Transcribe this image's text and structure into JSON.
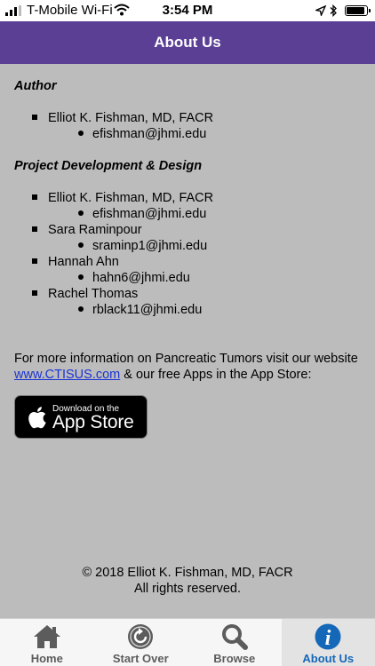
{
  "status_bar": {
    "carrier": "T-Mobile Wi-Fi",
    "time": "3:54 PM",
    "icons": [
      "signal-bars-icon",
      "wifi-icon",
      "location-arrow-icon",
      "bluetooth-icon",
      "battery-icon"
    ]
  },
  "header": {
    "title": "About Us"
  },
  "author_section": {
    "title": "Author",
    "people": [
      {
        "name": "Elliot K. Fishman, MD, FACR",
        "email": "efishman@jhmi.edu"
      }
    ]
  },
  "project_section": {
    "title": "Project Development & Design",
    "people": [
      {
        "name": "Elliot K. Fishman, MD, FACR",
        "email": "efishman@jhmi.edu"
      },
      {
        "name": "Sara Raminpour",
        "email": "sraminp1@jhmi.edu"
      },
      {
        "name": "Hannah Ahn",
        "email": "hahn6@jhmi.edu"
      },
      {
        "name": "Rachel Thomas",
        "email": "rblack11@jhmi.edu"
      }
    ]
  },
  "info": {
    "text_before": "For more information on Pancreatic Tumors visit our website",
    "link": "www.CTISUS.com",
    "text_after": " & our free Apps in the App Store:"
  },
  "app_store_badge": {
    "line1": "Download on the",
    "line2": "App Store"
  },
  "footer": {
    "copyright": "© 2018 Elliot K. Fishman, MD, FACR",
    "rights": "All rights reserved."
  },
  "tabs": [
    {
      "label": "Home",
      "icon": "home-icon",
      "active": false
    },
    {
      "label": "Start Over",
      "icon": "restart-icon",
      "active": false
    },
    {
      "label": "Browse",
      "icon": "magnifier-icon",
      "active": false
    },
    {
      "label": "About Us",
      "icon": "info-icon",
      "active": true
    }
  ],
  "colors": {
    "header": "#5b3f95",
    "background": "#bcbcbc",
    "link": "#1a33d6",
    "active_tab": "#1567b8"
  }
}
